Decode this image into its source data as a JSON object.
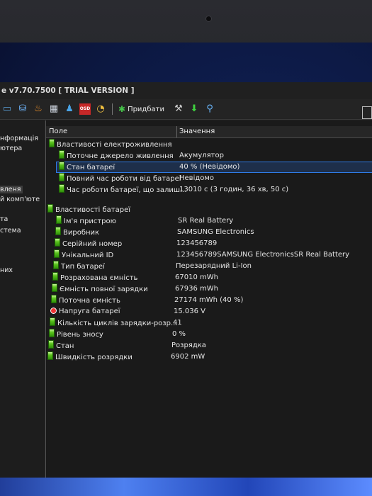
{
  "window": {
    "title": "e v7.70.7500  [ TRIAL VERSION ]"
  },
  "toolbar": {
    "icons": [
      "monitor-icon",
      "network-icon",
      "fire-icon",
      "computer-group-icon",
      "users-icon",
      "osd-icon",
      "clock-icon"
    ],
    "osd_label": "OSD",
    "add_label": "Придбати"
  },
  "left_pane": {
    "items": [
      "нформація",
      "ютера",
      "вленя",
      "й комп'юте",
      "та",
      "стема",
      "них"
    ]
  },
  "headers": {
    "field": "Поле",
    "value": "Значення"
  },
  "power_section": {
    "title": "Властивості електроживлення",
    "rows": [
      {
        "field": "Поточне джерело живлення",
        "value": "Акумулятор"
      },
      {
        "field": "Стан батареї",
        "value": "40 % (Невідомо)"
      },
      {
        "field": "Повний час роботи від батареї",
        "value": "Невідомо"
      },
      {
        "field": "Час роботи батареї, що залиш...",
        "value": "13010 с (3 годин, 36 хв, 50 с)"
      }
    ]
  },
  "battery_section": {
    "title": "Властивості батареї",
    "rows": [
      {
        "field": "Ім'я пристрою",
        "value": "SR Real Battery"
      },
      {
        "field": "Виробник",
        "value": "SAMSUNG Electronics"
      },
      {
        "field": "Серійний номер",
        "value": "123456789"
      },
      {
        "field": "Унікальний ID",
        "value": "123456789SAMSUNG ElectronicsSR Real Battery"
      },
      {
        "field": "Тип батареї",
        "value": "Перезарядний Li-Ion"
      },
      {
        "field": "Розрахована ємність",
        "value": "67010 mWh"
      },
      {
        "field": "Ємність повної зарядки",
        "value": "67936 mWh"
      },
      {
        "field": "Поточна ємність",
        "value": "27174 mWh  (40 %)"
      },
      {
        "field": "Напруга батареї",
        "value": "15.036 V"
      },
      {
        "field": "Кількість циклів зарядки-розр...",
        "value": "41"
      },
      {
        "field": "Рівень зносу",
        "value": "0 %"
      },
      {
        "field": "Стан",
        "value": "Розрядка"
      },
      {
        "field": "Швидкість розрядки",
        "value": "6902 mW"
      }
    ]
  }
}
